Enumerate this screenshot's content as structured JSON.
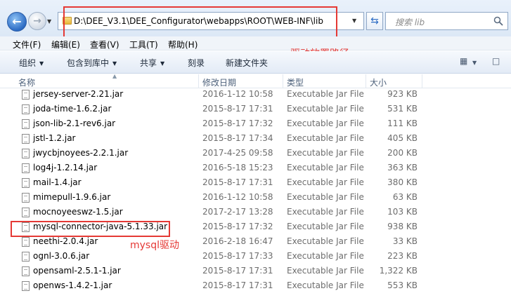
{
  "address": {
    "path": "D:\\DEE_V3.1\\DEE_Configurator\\webapps\\ROOT\\WEB-INF\\lib",
    "search_placeholder": "搜索 lib"
  },
  "menu": [
    "文件(F)",
    "编辑(E)",
    "查看(V)",
    "工具(T)",
    "帮助(H)"
  ],
  "toolbar": {
    "organize": "组织",
    "include_library": "包含到库中",
    "share": "共享",
    "burn": "刻录",
    "new_folder": "新建文件夹"
  },
  "columns": {
    "name": "名称",
    "date": "修改日期",
    "type": "类型",
    "size": "大小"
  },
  "annotations": {
    "driver_path": "驱动放置路径",
    "mysql_driver": "mysql驱动"
  },
  "files": [
    {
      "name": "jersey-server-2.21.jar",
      "date": "2016-1-12 10:58",
      "type": "Executable Jar File",
      "size": "923 KB"
    },
    {
      "name": "joda-time-1.6.2.jar",
      "date": "2015-8-17 17:31",
      "type": "Executable Jar File",
      "size": "531 KB"
    },
    {
      "name": "json-lib-2.1-rev6.jar",
      "date": "2015-8-17 17:32",
      "type": "Executable Jar File",
      "size": "111 KB"
    },
    {
      "name": "jstl-1.2.jar",
      "date": "2015-8-17 17:34",
      "type": "Executable Jar File",
      "size": "405 KB"
    },
    {
      "name": "jwycbjnoyees-2.2.1.jar",
      "date": "2017-4-25 09:58",
      "type": "Executable Jar File",
      "size": "200 KB"
    },
    {
      "name": "log4j-1.2.14.jar",
      "date": "2016-5-18 15:23",
      "type": "Executable Jar File",
      "size": "363 KB"
    },
    {
      "name": "mail-1.4.jar",
      "date": "2015-8-17 17:31",
      "type": "Executable Jar File",
      "size": "380 KB"
    },
    {
      "name": "mimepull-1.9.6.jar",
      "date": "2016-1-12 10:58",
      "type": "Executable Jar File",
      "size": "63 KB"
    },
    {
      "name": "mocnoyeeswz-1.5.jar",
      "date": "2017-2-17 13:28",
      "type": "Executable Jar File",
      "size": "103 KB"
    },
    {
      "name": "mysql-connector-java-5.1.33.jar",
      "date": "2015-8-17 17:32",
      "type": "Executable Jar File",
      "size": "938 KB"
    },
    {
      "name": "neethi-2.0.4.jar",
      "date": "2016-2-18 16:47",
      "type": "Executable Jar File",
      "size": "33 KB"
    },
    {
      "name": "ognl-3.0.6.jar",
      "date": "2015-8-17 17:33",
      "type": "Executable Jar File",
      "size": "223 KB"
    },
    {
      "name": "opensaml-2.5.1-1.jar",
      "date": "2015-8-17 17:31",
      "type": "Executable Jar File",
      "size": "1,322 KB"
    },
    {
      "name": "openws-1.4.2-1.jar",
      "date": "2015-8-17 17:31",
      "type": "Executable Jar File",
      "size": "553 KB"
    }
  ]
}
